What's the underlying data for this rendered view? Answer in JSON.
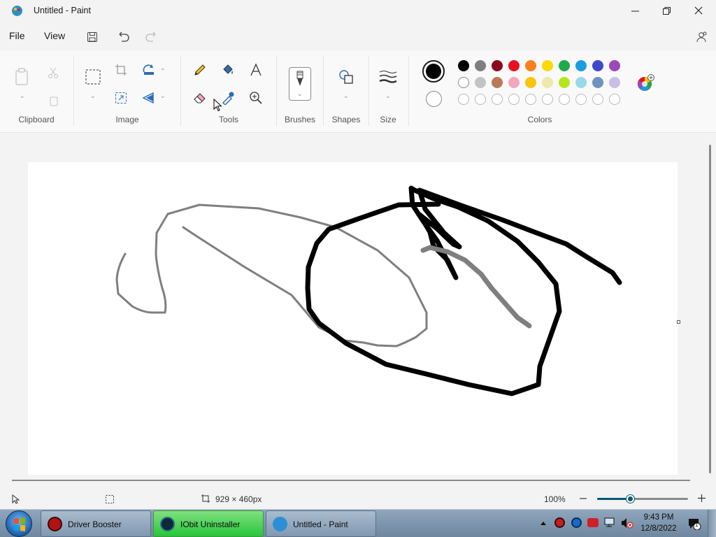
{
  "window": {
    "title": "Untitled - Paint"
  },
  "menu": {
    "file": "File",
    "view": "View"
  },
  "ribbon": {
    "groups": {
      "clipboard": "Clipboard",
      "image": "Image",
      "tools": "Tools",
      "brushes": "Brushes",
      "shapes": "Shapes",
      "size": "Size",
      "colors": "Colors"
    },
    "colors": {
      "primary": "#000000",
      "secondary": "#ffffff",
      "row1": [
        "#000000",
        "#7f7f7f",
        "#8b0a1f",
        "#e81123",
        "#f7801d",
        "#fcd900",
        "#1ea94a",
        "#1a9ee0",
        "#3f48cc",
        "#9b48b8"
      ],
      "row2": [
        "#ffffff",
        "#c3c3c3",
        "#b97a57",
        "#f2a6c0",
        "#f7c50d",
        "#eee8aa",
        "#b5e61d",
        "#99d9ea",
        "#7092be",
        "#c8bfe7"
      ],
      "row3_count": 10
    }
  },
  "status": {
    "canvas_size": "929 × 460px",
    "zoom": "100%",
    "zoom_level": 0.37
  },
  "taskbar": {
    "apps": [
      {
        "label": "Driver Booster"
      },
      {
        "label": "IObit Uninstaller"
      },
      {
        "label": "Untitled - Paint"
      }
    ],
    "time": "9:43 PM",
    "date": "12/8/2022",
    "notification_count": "1"
  }
}
